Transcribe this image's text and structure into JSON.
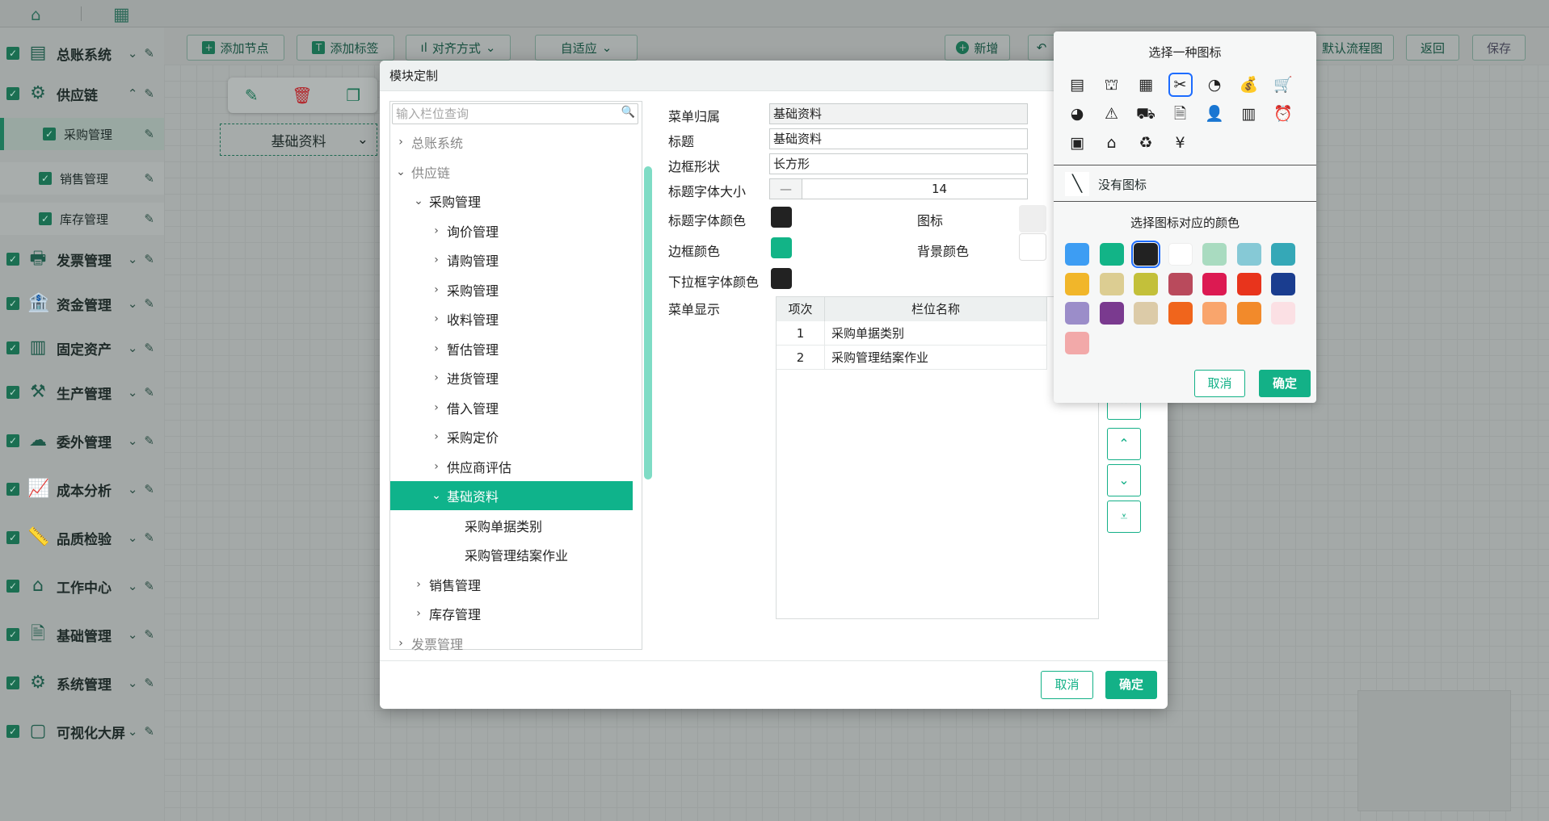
{
  "sidebar": {
    "items": [
      {
        "label": "总账系统",
        "icon": "ledger-icon"
      },
      {
        "label": "供应链",
        "icon": "gear-icon"
      },
      {
        "label": "采购管理",
        "icon": "",
        "sub": true
      },
      {
        "label": "销售管理",
        "icon": "",
        "sub": true
      },
      {
        "label": "库存管理",
        "icon": "",
        "sub": true
      },
      {
        "label": "发票管理",
        "icon": "invoice-icon"
      },
      {
        "label": "资金管理",
        "icon": "bank-icon"
      },
      {
        "label": "固定资产",
        "icon": "building-icon"
      },
      {
        "label": "生产管理",
        "icon": "production-icon"
      },
      {
        "label": "委外管理",
        "icon": "outsource-icon"
      },
      {
        "label": "成本分析",
        "icon": "chart-icon"
      },
      {
        "label": "品质检验",
        "icon": "ruler-icon"
      },
      {
        "label": "工作中心",
        "icon": "workcenter-icon"
      },
      {
        "label": "基础管理",
        "icon": "document-icon"
      },
      {
        "label": "系统管理",
        "icon": "settings-icon"
      },
      {
        "label": "可视化大屏",
        "icon": "screen-icon"
      }
    ]
  },
  "toolbar": {
    "add_node": "添加节点",
    "add_tag": "添加标签",
    "align": "对齐方式",
    "adapt": "自适应",
    "new": "新增",
    "default_flow": "默认流程图",
    "back": "返回",
    "save": "保存"
  },
  "canvas": {
    "node_label": "基础资料"
  },
  "modal": {
    "title": "模块定制",
    "search_placeholder": "输入栏位查询",
    "tree": [
      {
        "label": "总账系统",
        "level": 0,
        "caret": "›",
        "dim": true
      },
      {
        "label": "供应链",
        "level": 0,
        "caret": "⌄",
        "dim": true
      },
      {
        "label": "采购管理",
        "level": 1,
        "caret": "⌄"
      },
      {
        "label": "询价管理",
        "level": 2,
        "caret": "›"
      },
      {
        "label": "请购管理",
        "level": 2,
        "caret": "›"
      },
      {
        "label": "采购管理",
        "level": 2,
        "caret": "›"
      },
      {
        "label": "收料管理",
        "level": 2,
        "caret": "›"
      },
      {
        "label": "暂估管理",
        "level": 2,
        "caret": "›"
      },
      {
        "label": "进货管理",
        "level": 2,
        "caret": "›"
      },
      {
        "label": "借入管理",
        "level": 2,
        "caret": "›"
      },
      {
        "label": "采购定价",
        "level": 2,
        "caret": "›"
      },
      {
        "label": "供应商评估",
        "level": 2,
        "caret": "›"
      },
      {
        "label": "基础资料",
        "level": 2,
        "caret": "⌄",
        "selected": true
      },
      {
        "label": "采购单据类别",
        "level": 3,
        "caret": ""
      },
      {
        "label": "采购管理结案作业",
        "level": 3,
        "caret": ""
      },
      {
        "label": "销售管理",
        "level": 1,
        "caret": "›"
      },
      {
        "label": "库存管理",
        "level": 1,
        "caret": "›"
      },
      {
        "label": "发票管理",
        "level": 0,
        "caret": "›",
        "dim": true
      }
    ],
    "form": {
      "menu_owner_label": "菜单归属",
      "menu_owner_value": "基础资料",
      "title_label": "标题",
      "title_value": "基础资料",
      "border_shape_label": "边框形状",
      "border_shape_value": "长方形",
      "title_font_size_label": "标题字体大小",
      "title_font_size_value": "14",
      "stepper_minus": "—",
      "title_font_color_label": "标题字体颜色",
      "icon_label": "图标",
      "border_color_label": "边框颜色",
      "bg_color_label": "背景颜色",
      "dropdown_font_color_label": "下拉框字体颜色",
      "menu_display_label": "菜单显示"
    },
    "grid": {
      "headers": [
        "项次",
        "栏位名称"
      ],
      "rows": [
        [
          "1",
          "采购单据类别"
        ],
        [
          "2",
          "采购管理结案作业"
        ]
      ]
    },
    "cancel": "取消",
    "confirm": "确定"
  },
  "icon_popup": {
    "title": "选择一种图标",
    "icons": [
      "receipt-icon",
      "exhibit-icon",
      "calculator-icon",
      "tools-icon",
      "speedometer-icon",
      "moneybag-icon",
      "cart-icon",
      "piechart-icon",
      "warning-icon",
      "truck-icon",
      "document-settings-icon",
      "user-add-icon",
      "building-icon",
      "alarm-icon",
      "contact-book-icon",
      "house-icon",
      "recycle-icon",
      "yen-doc-icon"
    ],
    "icon_glyphs": [
      "▤",
      "⛫",
      "▦",
      "✂",
      "◔",
      "💰",
      "🛒",
      "◕",
      "⚠",
      "⛟",
      "🗎",
      "👤",
      "▥",
      "⏰",
      "▣",
      "⌂",
      "♻",
      "¥"
    ],
    "no_icon": "没有图标",
    "color_title": "选择图标对应的颜色",
    "colors": [
      "#3d9df3",
      "#12b487",
      "#222222",
      "#ffffff",
      "#a9dbc0",
      "#86c9d6",
      "#35a8b7",
      "#f1b62a",
      "#dccd92",
      "#c3c03a",
      "#b94a5c",
      "#dc1a52",
      "#e8341c",
      "#1a3d8f",
      "#9b8dc9",
      "#7a3a8f",
      "#dccba8",
      "#f0651c",
      "#f9a56c",
      "#f28a2b",
      "#fbe0e4",
      "#f2a9a9"
    ],
    "selected_color_index": 2,
    "cancel": "取消",
    "confirm": "确定"
  }
}
